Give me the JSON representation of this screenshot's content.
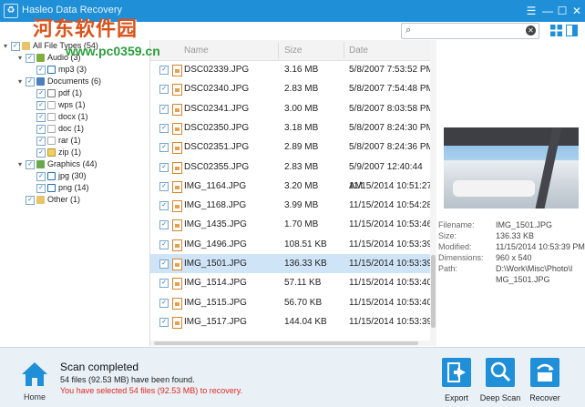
{
  "window": {
    "title": "Hasleo Data Recovery",
    "watermark_line1": "河东软件园",
    "watermark_line2": "www.pc0359.cn"
  },
  "search": {
    "placeholder": ""
  },
  "tree": [
    {
      "label": "All File Types (54)"
    },
    {
      "label": "Audio (3)"
    },
    {
      "label": "mp3 (3)"
    },
    {
      "label": "Documents (6)"
    },
    {
      "label": "pdf (1)"
    },
    {
      "label": "wps (1)"
    },
    {
      "label": "docx (1)"
    },
    {
      "label": "doc (1)"
    },
    {
      "label": "rar (1)"
    },
    {
      "label": "zip (1)"
    },
    {
      "label": "Graphics (44)"
    },
    {
      "label": "jpg (30)"
    },
    {
      "label": "png (14)"
    },
    {
      "label": "Other (1)"
    }
  ],
  "list": {
    "columns": {
      "name": "Name",
      "size": "Size",
      "date": "Date"
    },
    "rows": [
      {
        "name": "DSC02339.JPG",
        "size": "3.16 MB",
        "date": "5/8/2007 7:53:52 PM"
      },
      {
        "name": "DSC02340.JPG",
        "size": "2.83 MB",
        "date": "5/8/2007 7:54:48 PM"
      },
      {
        "name": "DSC02341.JPG",
        "size": "3.00 MB",
        "date": "5/8/2007 8:03:58 PM"
      },
      {
        "name": "DSC02350.JPG",
        "size": "3.18 MB",
        "date": "5/8/2007 8:24:30 PM"
      },
      {
        "name": "DSC02351.JPG",
        "size": "2.89 MB",
        "date": "5/8/2007 8:24:36 PM"
      },
      {
        "name": "DSC02355.JPG",
        "size": "2.83 MB",
        "date": "5/9/2007 12:40:44 AM"
      },
      {
        "name": "IMG_1164.JPG",
        "size": "3.20 MB",
        "date": "11/15/2014 10:51:27"
      },
      {
        "name": "IMG_1168.JPG",
        "size": "3.99 MB",
        "date": "11/15/2014 10:54:28"
      },
      {
        "name": "IMG_1435.JPG",
        "size": "1.70 MB",
        "date": "11/15/2014 10:53:46"
      },
      {
        "name": "IMG_1496.JPG",
        "size": "108.51 KB",
        "date": "11/15/2014 10:53:39"
      },
      {
        "name": "IMG_1501.JPG",
        "size": "136.33 KB",
        "date": "11/15/2014 10:53:39"
      },
      {
        "name": "IMG_1514.JPG",
        "size": "57.11 KB",
        "date": "11/15/2014 10:53:40"
      },
      {
        "name": "IMG_1515.JPG",
        "size": "56.70 KB",
        "date": "11/15/2014 10:53:40"
      },
      {
        "name": "IMG_1517.JPG",
        "size": "144.04 KB",
        "date": "11/15/2014 10:53:39"
      }
    ],
    "selected_index": 10
  },
  "preview": {
    "filename_label": "Filename:",
    "filename": "IMG_1501.JPG",
    "size_label": "Size:",
    "size": "136.33 KB",
    "modified_label": "Modified:",
    "modified": "11/15/2014 10:53:39 PM",
    "dimensions_label": "Dimensions:",
    "dimensions": "960 x 540",
    "path_label": "Path:",
    "path_line1": "D:\\Work\\Misc\\Photo\\I",
    "path_line2": "MG_1501.JPG"
  },
  "status": {
    "home_label": "Home",
    "title": "Scan completed",
    "found": "54 files (92.53 MB) have been found.",
    "selected": "You have selected 54 files (92.53 MB) to recovery."
  },
  "actions": {
    "export": "Export",
    "deep_scan": "Deep Scan",
    "recover": "Recover"
  },
  "colors": {
    "accent": "#1f8fd8",
    "selection": "#cfe4f7",
    "warning_text": "#e0281f"
  }
}
